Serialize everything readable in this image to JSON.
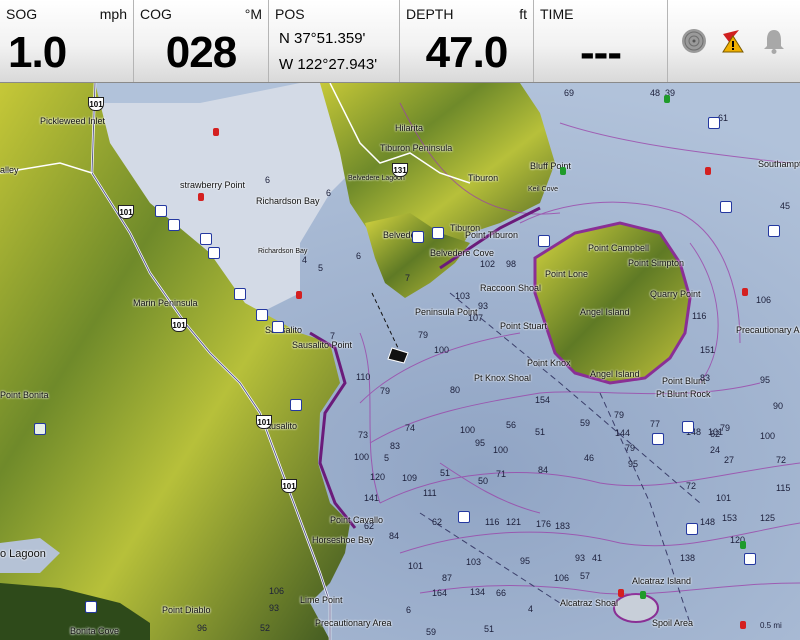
{
  "databar": {
    "sog": {
      "label": "SOG",
      "unit": "mph",
      "value": "1.0"
    },
    "cog": {
      "label": "COG",
      "unit": "°M",
      "value": "028"
    },
    "pos": {
      "label": "POS",
      "lat": "N  37°51.359'",
      "lon": "W 122°27.943'"
    },
    "depth": {
      "label": "DEPTH",
      "unit": "ft",
      "value": "47.0"
    },
    "time": {
      "label": "TIME",
      "value": "---"
    },
    "icons": [
      "radar-icon",
      "alarm-warning-icon",
      "bell-icon"
    ]
  },
  "colors": {
    "land_hi": "#c9c930",
    "land_lo": "#3f5a1e",
    "water": "#a9bdd6",
    "shallow": "#c8d2e0",
    "contour": "#9b3fa8",
    "highway": "#ffffff"
  },
  "map": {
    "place_labels": [
      {
        "id": "pickleweed-inlet",
        "text": "Pickleweed Inlet"
      },
      {
        "id": "valley",
        "text": "alley"
      },
      {
        "id": "strawberry-point",
        "text": "strawberry Point"
      },
      {
        "id": "richardson-bay",
        "text": "Richardson Bay"
      },
      {
        "id": "richardson-bay-small",
        "text": "Richardson Bay"
      },
      {
        "id": "hilarita",
        "text": "Hilarita"
      },
      {
        "id": "tiburon-peninsula",
        "text": "Tiburon Peninsula"
      },
      {
        "id": "belvedere-lagoon",
        "text": "Belvedere Lagoon"
      },
      {
        "id": "tiburon",
        "text": "Tiburon"
      },
      {
        "id": "tiburon2",
        "text": "Tiburon"
      },
      {
        "id": "bluff-point",
        "text": "Bluff Point"
      },
      {
        "id": "keil-cove",
        "text": "Keil Cove"
      },
      {
        "id": "belvedere",
        "text": "Belvedere"
      },
      {
        "id": "point-tiburon",
        "text": "Point Tiburon"
      },
      {
        "id": "belvedere-cove",
        "text": "Belvedere Cove"
      },
      {
        "id": "southampton",
        "text": "Southampto"
      },
      {
        "id": "point-campbell",
        "text": "Point Campbell"
      },
      {
        "id": "point-simpton",
        "text": "Point Simpton"
      },
      {
        "id": "point-lone",
        "text": "Point Lone"
      },
      {
        "id": "raccoon-shoal",
        "text": "Raccoon Shoal"
      },
      {
        "id": "marin-peninsula",
        "text": "Marin Peninsula"
      },
      {
        "id": "sausalito",
        "text": "Sausalito"
      },
      {
        "id": "sausalito-point",
        "text": "Sausalito Point"
      },
      {
        "id": "peninsula-point",
        "text": "Peninsula Point"
      },
      {
        "id": "point-stuart",
        "text": "Point Stuart"
      },
      {
        "id": "angel-island",
        "text": "Angel Island"
      },
      {
        "id": "quarry-point",
        "text": "Quarry Point"
      },
      {
        "id": "precautionary-area",
        "text": "Precautionary Area"
      },
      {
        "id": "point-knox",
        "text": "Point Knox"
      },
      {
        "id": "pt-knox-shoal",
        "text": "Pt Knox Shoal"
      },
      {
        "id": "angel-island2",
        "text": "Angel Island"
      },
      {
        "id": "point-blunt",
        "text": "Point Blunt"
      },
      {
        "id": "pt-blunt-rock",
        "text": "Pt Blunt Rock"
      },
      {
        "id": "point-bonita",
        "text": "Point Bonita"
      },
      {
        "id": "sausalito2",
        "text": "Sausalito"
      },
      {
        "id": "point-cavallo",
        "text": "Point Cavallo"
      },
      {
        "id": "horseshoe-bay",
        "text": "Horseshoe Bay"
      },
      {
        "id": "lagoon",
        "text": "o Lagoon"
      },
      {
        "id": "point-diablo",
        "text": "Point Diablo"
      },
      {
        "id": "lime-point",
        "text": "Lime Point"
      },
      {
        "id": "bonita-cove",
        "text": "Bonita Cove"
      },
      {
        "id": "precautionary-area2",
        "text": "Precautionary Area"
      },
      {
        "id": "alcatraz-island",
        "text": "Alcatraz Island"
      },
      {
        "id": "alcatraz-shoal",
        "text": "Alcatraz Shoal"
      },
      {
        "id": "spoil-area",
        "text": "Spoil Area"
      }
    ],
    "highways": [
      "101",
      "101",
      "101",
      "101",
      "101",
      "131"
    ],
    "soundings": [
      "69",
      "48",
      "39",
      "6",
      "61",
      "45",
      "6",
      "4",
      "6",
      "5",
      "7",
      "103",
      "93",
      "102",
      "98",
      "107",
      "116",
      "151",
      "79",
      "80",
      "79",
      "56",
      "7",
      "106",
      "83",
      "95",
      "77",
      "100",
      "154",
      "73",
      "74",
      "100",
      "83",
      "79",
      "100",
      "95",
      "51",
      "59",
      "46",
      "51",
      "50",
      "84",
      "79",
      "100",
      "100",
      "79",
      "90",
      "5",
      "24",
      "27",
      "62",
      "144",
      "148",
      "120",
      "141",
      "109",
      "111",
      "62",
      "116",
      "121",
      "101",
      "62",
      "84",
      "148",
      "120",
      "101",
      "87",
      "93",
      "95",
      "106",
      "138",
      "41",
      "57",
      "103",
      "66",
      "164",
      "134",
      "106",
      "93",
      "96",
      "52",
      "6",
      "4",
      "59",
      "51",
      "115",
      "110",
      "72",
      "72",
      "71",
      "176",
      "183",
      "101",
      "153",
      "125",
      "95"
    ],
    "scale": "0.5 mi"
  }
}
